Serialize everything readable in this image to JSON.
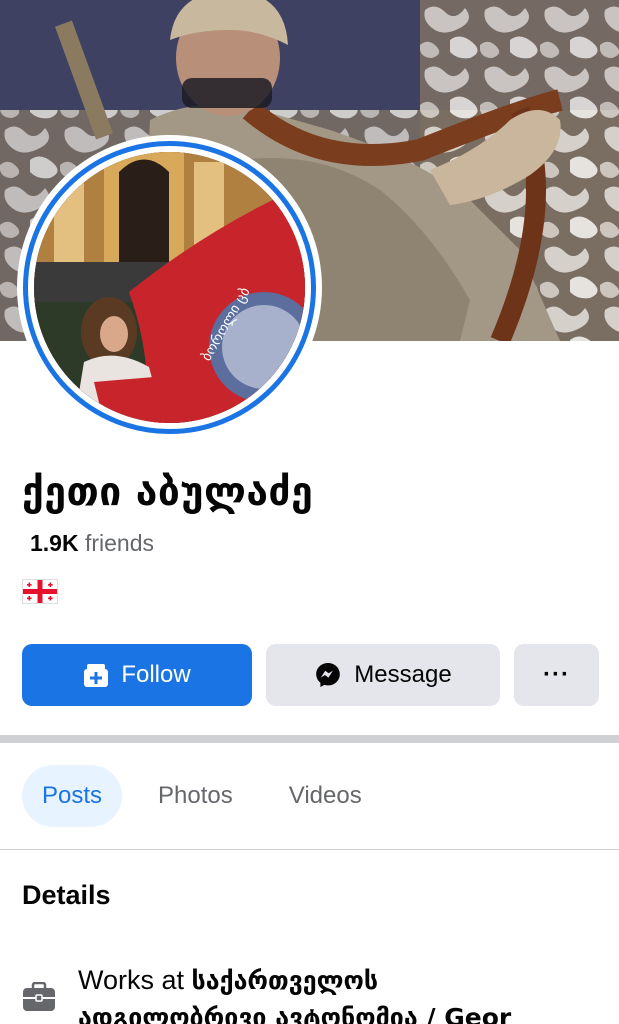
{
  "profile": {
    "name": "ქეთი აბულაძე",
    "friends_count": "1.9K",
    "friends_label": "friends",
    "flag_icon": "georgia-flag-icon"
  },
  "avatar_image": {
    "flag_text": "ბოროლი ცბ"
  },
  "actions": {
    "follow_label": "Follow",
    "message_label": "Message",
    "more_label": "···"
  },
  "tabs": [
    {
      "label": "Posts",
      "active": true
    },
    {
      "label": "Photos",
      "active": false
    },
    {
      "label": "Videos",
      "active": false
    }
  ],
  "details": {
    "title": "Details",
    "work_prefix": "Works at ",
    "work_org": "საქართველოს",
    "work_org_line2": "ადგილობრივი ავტონომია / Geor"
  },
  "colors": {
    "accent": "#1b74e4",
    "secondary_button": "#e4e6eb",
    "muted_text": "#65676b",
    "flag_red": "#e8112d"
  }
}
